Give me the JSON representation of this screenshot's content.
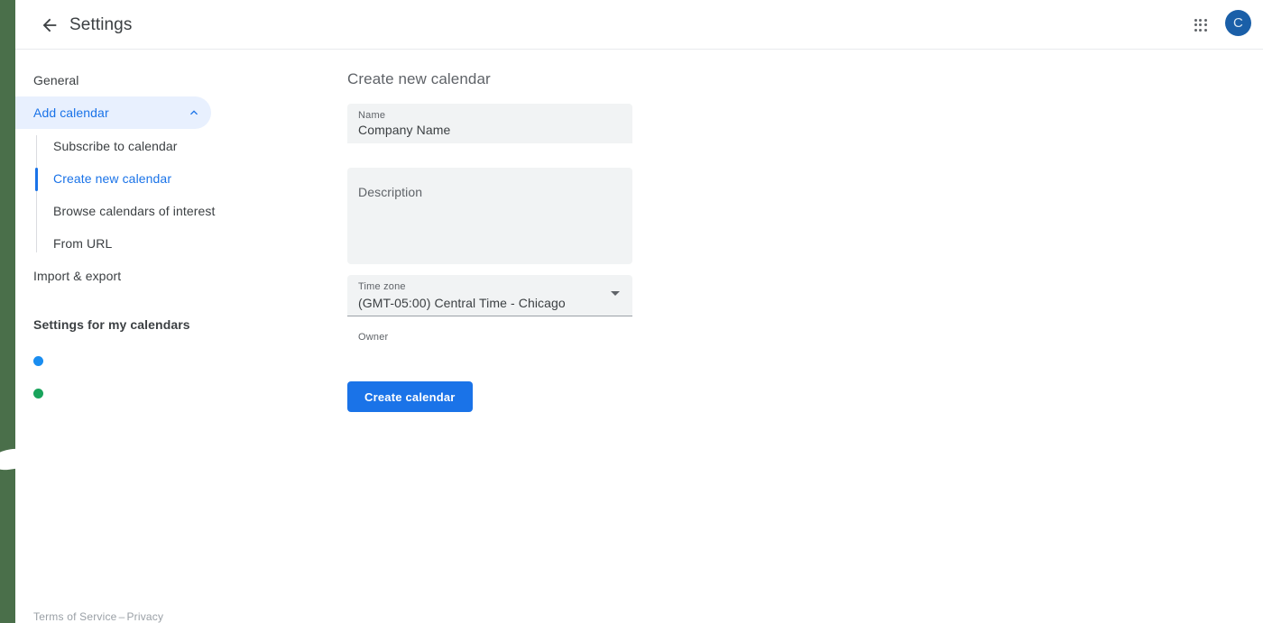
{
  "header": {
    "back_icon": "arrow-left-icon",
    "title": "Settings",
    "apps_icon": "apps-grid-icon",
    "avatar_initial": "C"
  },
  "sidebar": {
    "general_label": "General",
    "add_calendar": {
      "label": "Add calendar",
      "chevron_icon": "chevron-up-icon",
      "expanded": true,
      "items": [
        {
          "label": "Subscribe to calendar",
          "active": false
        },
        {
          "label": "Create new calendar",
          "active": true
        },
        {
          "label": "Browse calendars of interest",
          "active": false
        },
        {
          "label": "From URL",
          "active": false
        }
      ]
    },
    "import_export_label": "Import & export",
    "my_calendars": {
      "heading": "Settings for my calendars",
      "items": [
        {
          "label": "",
          "color": "#1a8df0"
        },
        {
          "label": "",
          "color": "#19a45c"
        }
      ]
    },
    "ghost_row": "",
    "footer": {
      "terms": "Terms of Service",
      "separator": "–",
      "privacy": "Privacy"
    }
  },
  "main": {
    "title": "Create new calendar",
    "name_field": {
      "label": "Name",
      "value": "Company Name"
    },
    "description_field": {
      "placeholder": "Description",
      "value": ""
    },
    "timezone_field": {
      "label": "Time zone",
      "value": "(GMT-05:00) Central Time - Chicago",
      "caret_icon": "chevron-down-icon"
    },
    "owner_field": {
      "label": "Owner",
      "value": ""
    },
    "create_button": "Create calendar"
  },
  "colors": {
    "accent": "#1a73e8",
    "pill_bg": "#e8f0fe",
    "field_bg": "#f1f3f4",
    "edge_strip": "#4a6f4a",
    "avatar_bg": "#1a5fa8"
  }
}
